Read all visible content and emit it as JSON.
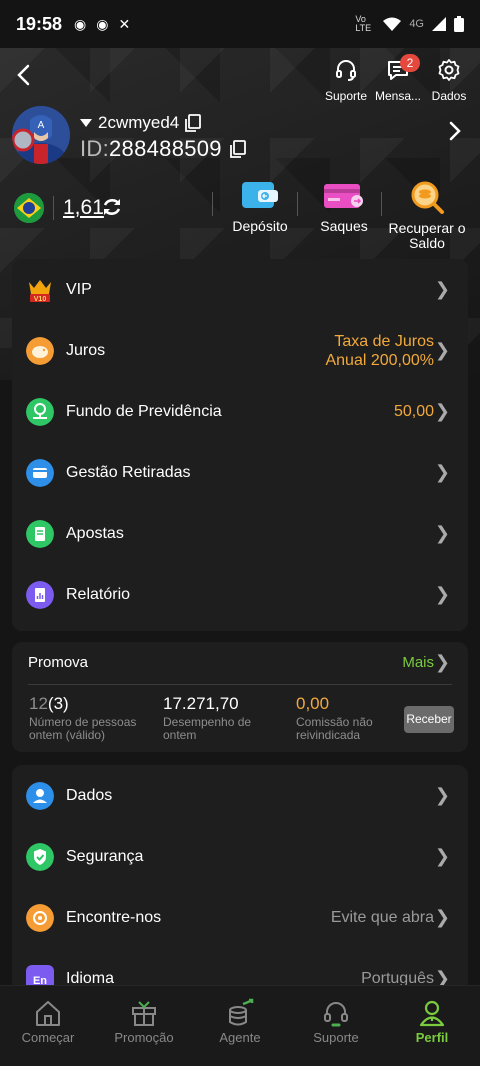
{
  "status_bar": {
    "time": "19:58",
    "network": "4G",
    "volte": "Vo LTE"
  },
  "header": {
    "support_label": "Suporte",
    "messages_label": "Mensa...",
    "messages_badge": "2",
    "data_label": "Dados"
  },
  "profile": {
    "username": "2cwmyed4",
    "id_prefix": "ID:",
    "id_value": "288488509"
  },
  "balance": {
    "amount": "1,61",
    "actions": [
      {
        "label": "Depósito"
      },
      {
        "label": "Saques"
      },
      {
        "label": "Recuperar o Saldo"
      }
    ]
  },
  "menu": [
    {
      "label": "VIP",
      "value": ""
    },
    {
      "label": "Juros",
      "value": "Taxa de Juros\nAnual 200,00%"
    },
    {
      "label": "Fundo de Previdência",
      "value": "50,00"
    },
    {
      "label": "Gestão Retiradas",
      "value": ""
    },
    {
      "label": "Apostas",
      "value": ""
    },
    {
      "label": "Relatório",
      "value": ""
    }
  ],
  "promo": {
    "title": "Promova",
    "more": "Mais",
    "people_count": "12",
    "people_valid": "(3)",
    "people_desc": "Número de pessoas ontem (válido)",
    "performance": "17.271,70",
    "performance_desc": "Desempenho de ontem",
    "commission": "0,00",
    "commission_desc": "Comissão não reivindicada",
    "receive_button": "Receber"
  },
  "menu2": [
    {
      "label": "Dados",
      "value": ""
    },
    {
      "label": "Segurança",
      "value": ""
    },
    {
      "label": "Encontre-nos",
      "value": "Evite que abra"
    },
    {
      "label": "Idioma",
      "value": "Português"
    }
  ],
  "bottom_nav": [
    {
      "label": "Começar"
    },
    {
      "label": "Promoção"
    },
    {
      "label": "Agente"
    },
    {
      "label": "Suporte"
    },
    {
      "label": "Perfil"
    }
  ],
  "colors": {
    "accent_green": "#7acb3e",
    "gold": "#f2a93b",
    "badge_red": "#e5483c",
    "background": "#151515",
    "card": "#1e1e1e"
  }
}
